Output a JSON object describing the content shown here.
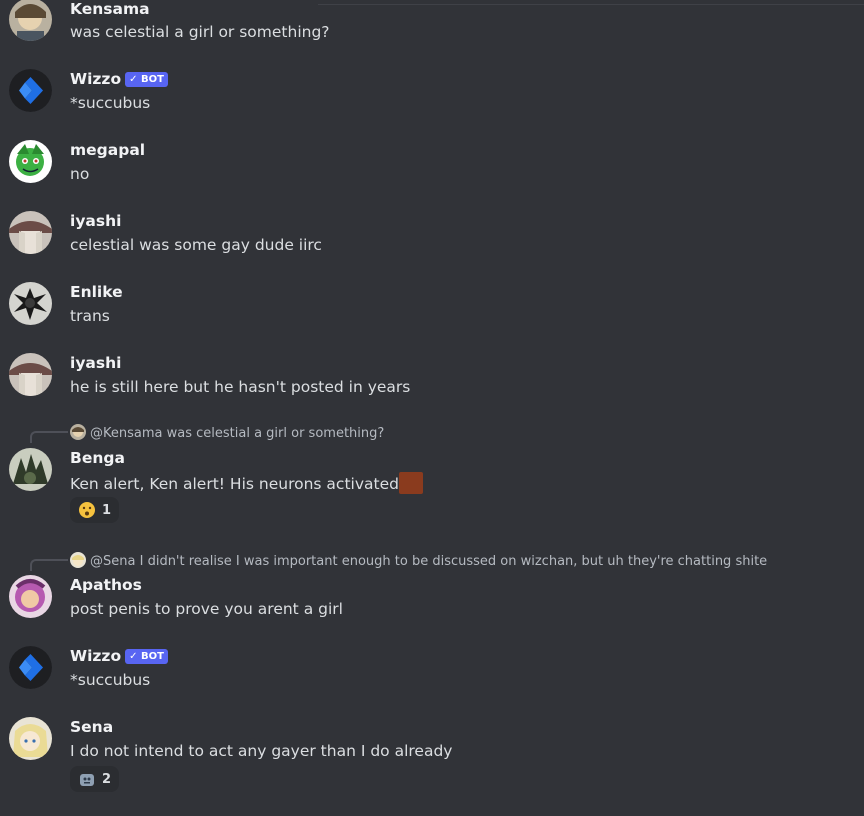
{
  "messages": [
    {
      "author": "Kensama",
      "text": "was celestial a girl or something?"
    },
    {
      "author": "Wizzo",
      "bot_label": "✓ BOT",
      "text": "*succubus"
    },
    {
      "author": "megapal",
      "text": "no"
    },
    {
      "author": "iyashi",
      "text": "celestial was some gay dude iirc"
    },
    {
      "author": "Enlike",
      "text": "trans"
    },
    {
      "author": "iyashi",
      "text": "he is still here but he hasn't posted in years"
    },
    {
      "author": "Benga",
      "reply": {
        "mention": "@Kensama",
        "text": "was celestial a girl or something?"
      },
      "text": "Ken alert, Ken alert! His neurons activated",
      "reaction": {
        "emoji": "hushed-face",
        "count": "1"
      }
    },
    {
      "author": "Apathos",
      "reply": {
        "mention": "@Sena",
        "text": "I didn't realise I was important enough to be discussed on wizchan, but uh they're chatting shite"
      },
      "text": "post penis to prove you arent a girl"
    },
    {
      "author": "Wizzo",
      "bot_label": "✓ BOT",
      "text": "*succubus"
    },
    {
      "author": "Sena",
      "text": "I do not intend to act any gayer than I do already",
      "reaction": {
        "emoji": "custom-emoji",
        "count": "2"
      }
    }
  ],
  "colors": {
    "background": "#313338",
    "bot_badge": "#5865f2",
    "text": "#dbdee1",
    "username": "#f2f3f5"
  }
}
